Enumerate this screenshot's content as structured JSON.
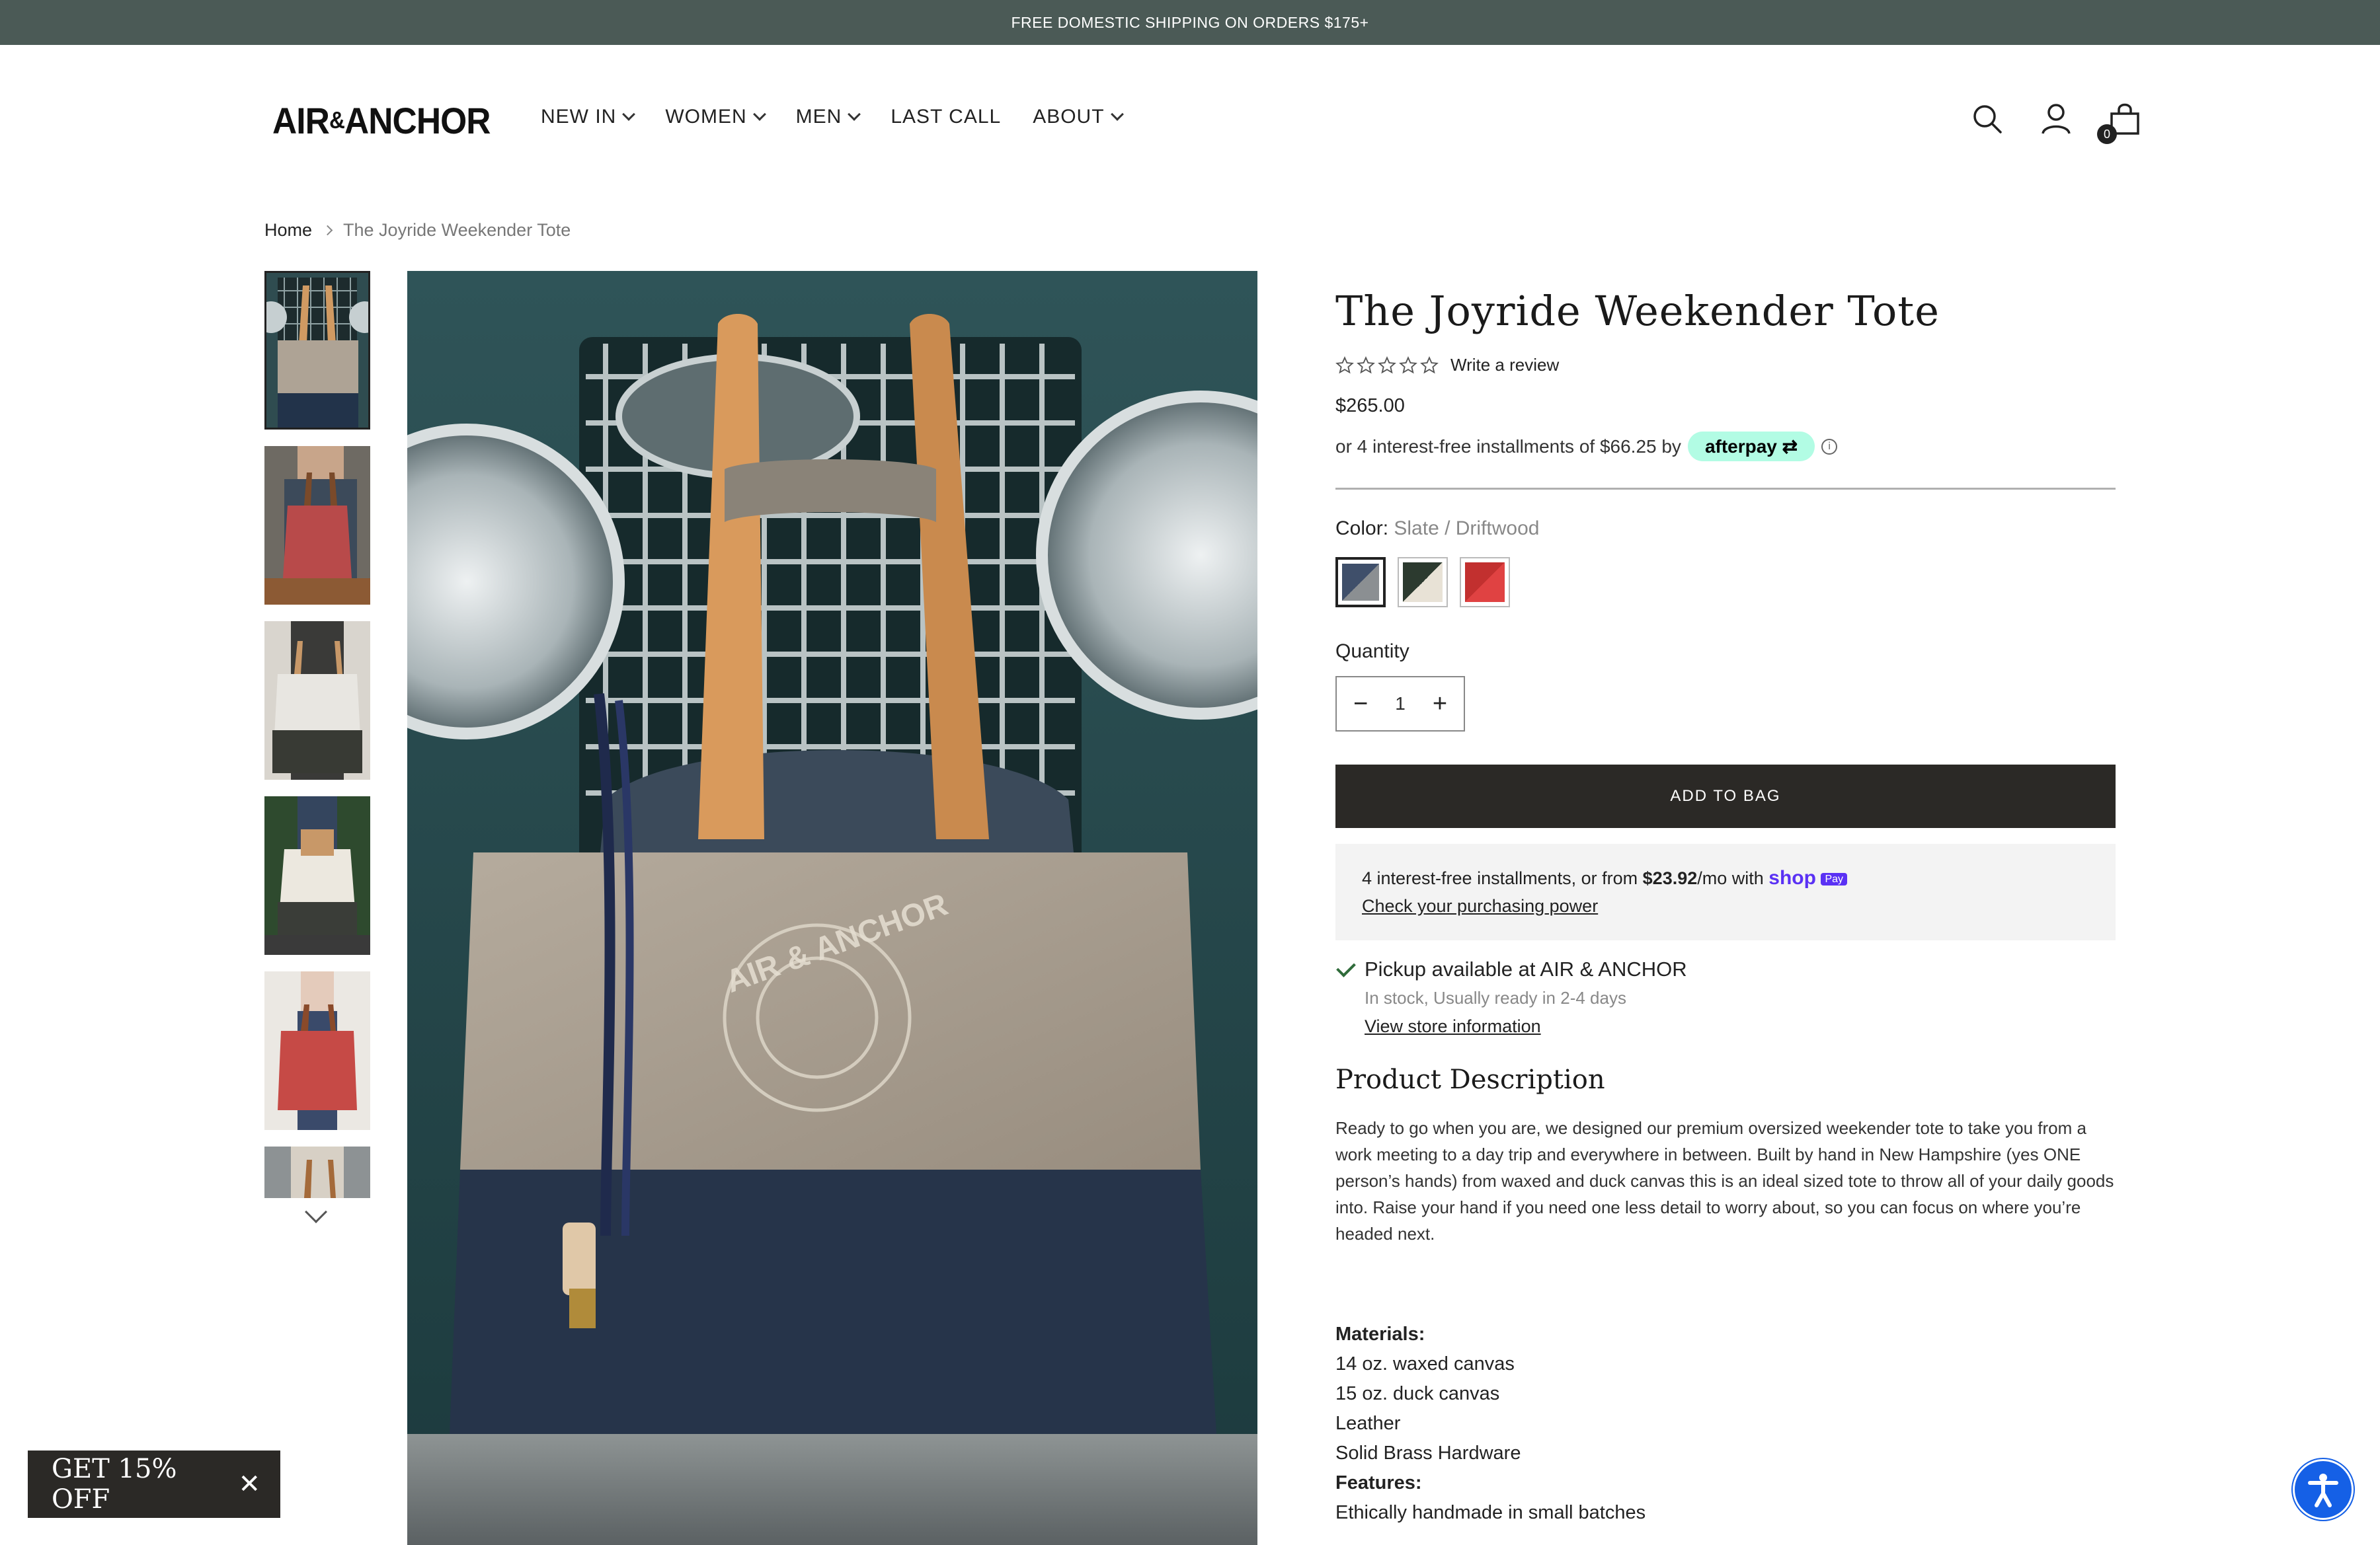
{
  "announcement": {
    "text": "FREE DOMESTIC SHIPPING ON ORDERS $175+"
  },
  "header": {
    "logo_main": "AIR",
    "logo_amp": "&",
    "logo_end": "ANCHOR",
    "nav": [
      {
        "label": "NEW IN",
        "dropdown": true
      },
      {
        "label": "WOMEN",
        "dropdown": true
      },
      {
        "label": "MEN",
        "dropdown": true
      },
      {
        "label": "LAST CALL",
        "dropdown": false
      },
      {
        "label": "ABOUT",
        "dropdown": true
      }
    ],
    "icons": [
      "search-icon",
      "account-icon",
      "bag-icon"
    ],
    "cart_count": "0"
  },
  "breadcrumb": {
    "home": "Home",
    "current": "The Joyride Weekender Tote"
  },
  "gallery": {
    "thumbnails": [
      "tote-slate-front",
      "tote-red-model",
      "tote-white-model",
      "tote-white-held",
      "tote-red-held",
      "tote-partial"
    ]
  },
  "product": {
    "title": "The Joyride Weekender Tote",
    "review_link": "Write a review",
    "rating": 0,
    "price": "$265.00",
    "afterpay_text": "or 4 interest-free installments of $66.25 by",
    "afterpay_brand": "afterpay",
    "color_label": "Color:",
    "color_value": "Slate / Driftwood",
    "swatches": [
      {
        "name": "Slate / Driftwood",
        "colors": [
          "#3f4f6a",
          "#8b8f92"
        ]
      },
      {
        "name": "Olive / Natural",
        "colors": [
          "#2c3a2f",
          "#e8e2d6"
        ]
      },
      {
        "name": "Red",
        "colors": [
          "#c2302f",
          "#e04242"
        ]
      }
    ],
    "quantity_label": "Quantity",
    "quantity": "1",
    "add_to_bag": "ADD TO BAG",
    "shoppay": {
      "text_before": "4 interest-free installments, or from ",
      "amount": "$23.92",
      "text_after": "/mo with ",
      "brand": "shop",
      "brand_pay": "Pay",
      "link": "Check your purchasing power"
    },
    "pickup": {
      "title": "Pickup available at AIR & ANCHOR",
      "status": "In stock, Usually ready in 2-4 days",
      "link": "View store information"
    },
    "description_heading": "Product Description",
    "description": "Ready to go when you are, we designed our premium oversized weekender tote to take you from a work meeting to a day trip and everywhere in between. Built by hand in New Hampshire (yes ONE person’s hands) from waxed and duck canvas this is an ideal sized tote to throw all of your daily goods into. Raise your hand if you need one less detail to worry about, so you can focus on where you’re headed next.",
    "materials_heading": "Materials:",
    "materials": [
      "14 oz. waxed canvas",
      "15 oz. duck canvas",
      "Leather",
      "Solid Brass Hardware"
    ],
    "features_heading": "Features:",
    "features": [
      "Ethically handmade in small batches"
    ]
  },
  "promo": {
    "label": "GET 15% OFF"
  },
  "colors": {
    "announcement_bg": "#4b5a56",
    "button_bg": "#2b2926",
    "afterpay": "#b2fce4",
    "shoppay": "#5a31f4",
    "accessibility": "#1560e6"
  }
}
